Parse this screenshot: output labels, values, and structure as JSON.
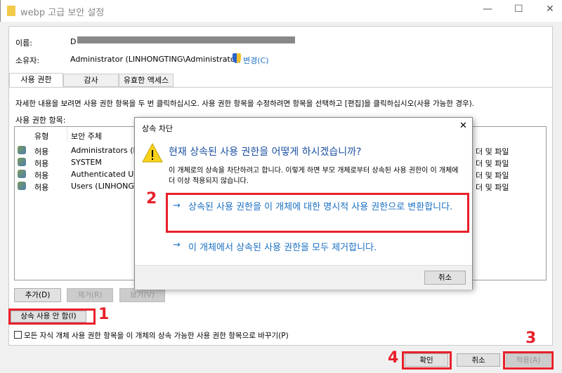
{
  "window": {
    "title": "webp 고급 보안 설정",
    "minimize": "—",
    "maximize": "☐",
    "close": "✕"
  },
  "name_label": "이름:",
  "name_value": "D",
  "owner_label": "소유자:",
  "owner_value": "Administrator (LINHONGTING\\Administrator)",
  "owner_change": "변경(C)",
  "tabs": [
    {
      "label": "사용 권한"
    },
    {
      "label": "감사"
    },
    {
      "label": "유효한 액세스"
    }
  ],
  "instructions": "자세한 내용을 보려면 사용 권한 항목을 두 번 클릭하십시오. 사용 권한 항목을 수정하려면 항목을 선택하고 [편집]을 클릭하십시오(사용 가능한 경우).",
  "entries_label": "사용 권한 항목:",
  "columns": [
    "유형",
    "보안 주체"
  ],
  "rows": [
    {
      "type": "허용",
      "principal": "Administrators (LIN",
      "applies": "더 및 파일"
    },
    {
      "type": "허용",
      "principal": "SYSTEM",
      "applies": "더 및 파일"
    },
    {
      "type": "허용",
      "principal": "Authenticated User",
      "applies": "더 및 파일"
    },
    {
      "type": "허용",
      "principal": "Users (LINHONGTIN",
      "applies": "더 및 파일"
    }
  ],
  "buttons": {
    "add": "추가(D)",
    "remove": "제거(R)",
    "view": "보기(V)",
    "disable_inheritance": "상속 사용 안 함(I)",
    "ok": "확인",
    "cancel": "취소",
    "apply": "적용(A)"
  },
  "replace_checkbox": "모든 자식 개체 사용 권한 항목을 이 개체의 상속 가능한 사용 권한 항목으로 바꾸기(P)",
  "dialog": {
    "title": "상속 차단",
    "close": "✕",
    "question": "현재 상속된 사용 권한을 어떻게 하시겠습니까?",
    "description": "이 개체로의 상속을 차단하려고 합니다. 이렇게 하면 부모 개체로부터 상속된 사용 권한이 이 개체에 더 이상 적용되지 않습니다.",
    "option_convert": "상속된 사용 권한을 이 개체에 대한 명시적 사용 권한으로 변환합니다.",
    "option_remove": "이 개체에서 상속된 사용 권한을 모두 제거합니다.",
    "arrow": "→",
    "cancel": "취소"
  },
  "annotations": [
    "1",
    "2",
    "3",
    "4"
  ]
}
